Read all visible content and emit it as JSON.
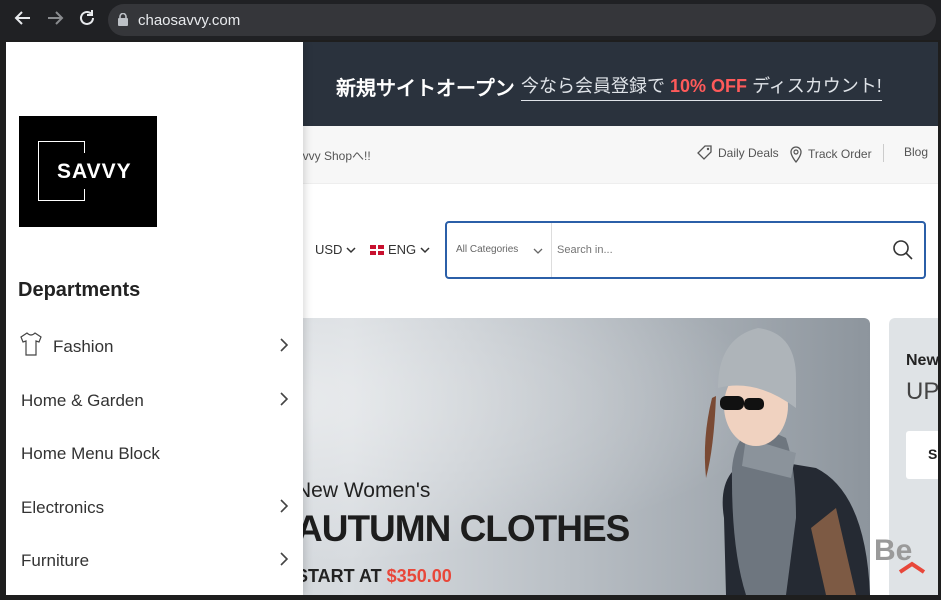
{
  "browser": {
    "url": "chaosavvy.com",
    "icons": [
      "back-arrow-icon",
      "forward-arrow-icon",
      "reload-icon",
      "lock-icon"
    ]
  },
  "promo_bar": {
    "title": "新規サイトオープン",
    "offer_prefix": "今なら会員登録で",
    "offer_highlight": "10% OFF",
    "offer_suffix": "ディスカウント!"
  },
  "subheader": {
    "welcome_partial": "avvy Shopへ!!",
    "links": [
      {
        "label": "Daily Deals",
        "icon": "tag-icon"
      },
      {
        "label": "Track Order",
        "icon": "location-pin-icon"
      },
      {
        "label": "Blog"
      }
    ]
  },
  "search_row": {
    "currency": "USD",
    "language": "ENG",
    "category_select": "All Categories",
    "search_placeholder": "Search in..."
  },
  "banner": {
    "line1": "New Women's",
    "line2": "AUTUMN CLOTHES",
    "line3_prefix": "START AT",
    "price": "$350.00"
  },
  "side_card": {
    "line1": "New",
    "line2": "UP",
    "button": "S"
  },
  "drawer": {
    "logo_text": "SAVVY",
    "departments_title": "Departments",
    "items": [
      {
        "label": "Fashion",
        "has_icon": true,
        "has_arrow": true
      },
      {
        "label": "Home & Garden",
        "has_arrow": true
      },
      {
        "label": "Home Menu Block",
        "has_arrow": false
      },
      {
        "label": "Electronics",
        "has_arrow": true
      },
      {
        "label": "Furniture",
        "has_arrow": true
      }
    ]
  },
  "watermark": "Be",
  "colors": {
    "promo_bg": "#2a323d",
    "accent_red": "#ff5a5a",
    "search_border": "#2b5fa8",
    "price_red": "#e8473a"
  }
}
